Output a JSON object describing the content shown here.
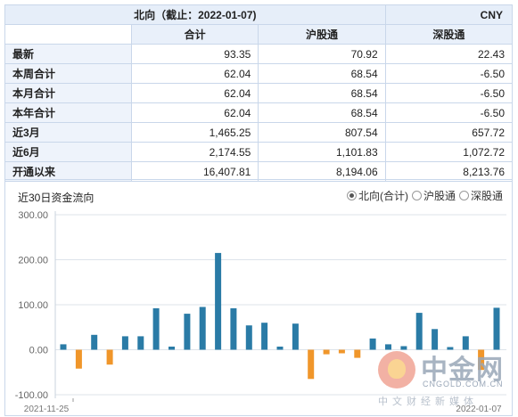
{
  "table": {
    "title": "北向（截止：2022-01-07)",
    "currency": "CNY",
    "columns": [
      "合计",
      "沪股通",
      "深股通"
    ],
    "rows": [
      {
        "label": "最新",
        "values": [
          "93.35",
          "70.92",
          "22.43"
        ]
      },
      {
        "label": "本周合计",
        "values": [
          "62.04",
          "68.54",
          "-6.50"
        ]
      },
      {
        "label": "本月合计",
        "values": [
          "62.04",
          "68.54",
          "-6.50"
        ]
      },
      {
        "label": "本年合计",
        "values": [
          "62.04",
          "68.54",
          "-6.50"
        ]
      },
      {
        "label": "近3月",
        "values": [
          "1,465.25",
          "807.54",
          "657.72"
        ]
      },
      {
        "label": "近6月",
        "values": [
          "2,174.55",
          "1,101.83",
          "1,072.72"
        ]
      },
      {
        "label": "开通以来",
        "values": [
          "16,407.81",
          "8,194.06",
          "8,213.76"
        ]
      }
    ]
  },
  "chart_panel": {
    "title": "近30日资金流向",
    "options": [
      {
        "label": "北向(合计)",
        "selected": true
      },
      {
        "label": "沪股通",
        "selected": false
      },
      {
        "label": "深股通",
        "selected": false
      }
    ]
  },
  "chart_data": {
    "type": "bar",
    "x_start_label": "2021-11-25",
    "x_end_label": "2022-01-07",
    "yticks": [
      "300.00",
      "200.00",
      "100.00",
      "0.00",
      "-100.00"
    ],
    "ylim": [
      -100,
      300
    ],
    "grid": true,
    "values": [
      12,
      -42,
      33,
      -33,
      30,
      30,
      92,
      7,
      80,
      95,
      215,
      92,
      54,
      60,
      7,
      58,
      -65,
      -10,
      -8,
      -18,
      25,
      12,
      8,
      82,
      46,
      6,
      30,
      -45,
      93.35
    ],
    "colors": {
      "positive": "#2a7ba6",
      "negative": "#f0962a"
    }
  },
  "watermark": {
    "name": "中金网",
    "url": "CNGOLD.COM.CN",
    "tagline": "中文财经新媒体"
  }
}
